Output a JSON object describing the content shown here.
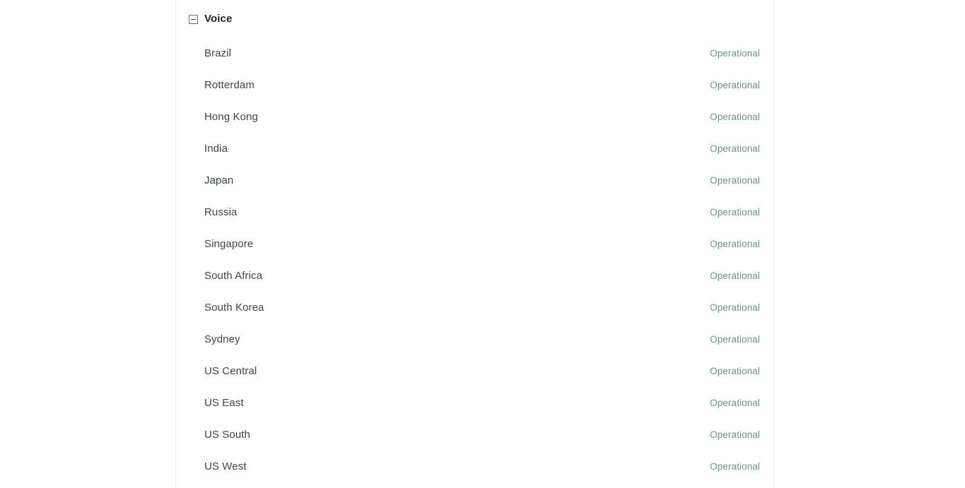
{
  "page": {
    "background_color": "#ffffff",
    "column_border_color": "#eceef0"
  },
  "group": {
    "title": "Voice",
    "collapse_icon": "minus-square-collapse-icon",
    "expanded": true,
    "title_color": "#1f2326"
  },
  "status_colors": {
    "operational": "#6f9480",
    "region_name": "#3d4347"
  },
  "regions": [
    {
      "name": "Brazil",
      "status": "Operational"
    },
    {
      "name": "Rotterdam",
      "status": "Operational"
    },
    {
      "name": "Hong Kong",
      "status": "Operational"
    },
    {
      "name": "India",
      "status": "Operational"
    },
    {
      "name": "Japan",
      "status": "Operational"
    },
    {
      "name": "Russia",
      "status": "Operational"
    },
    {
      "name": "Singapore",
      "status": "Operational"
    },
    {
      "name": "South Africa",
      "status": "Operational"
    },
    {
      "name": "South Korea",
      "status": "Operational"
    },
    {
      "name": "Sydney",
      "status": "Operational"
    },
    {
      "name": "US Central",
      "status": "Operational"
    },
    {
      "name": "US East",
      "status": "Operational"
    },
    {
      "name": "US South",
      "status": "Operational"
    },
    {
      "name": "US West",
      "status": "Operational"
    }
  ]
}
